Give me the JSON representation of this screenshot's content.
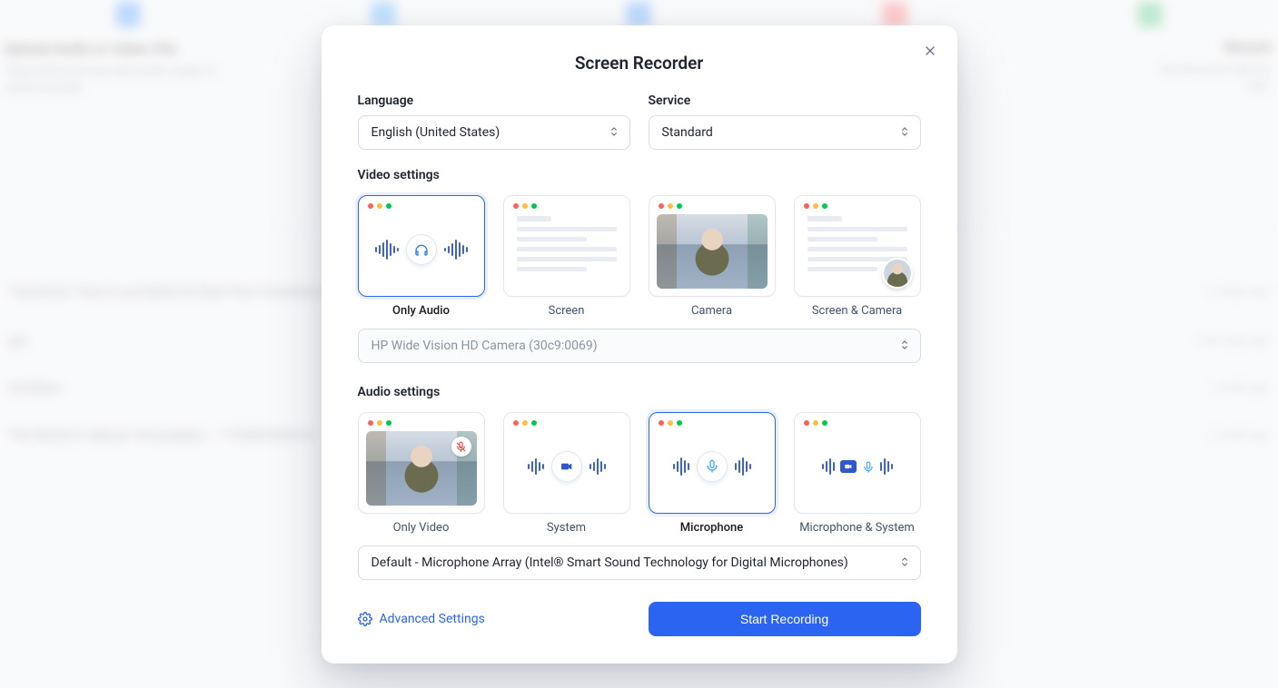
{
  "modal": {
    "title": "Screen Recorder",
    "language": {
      "label": "Language",
      "value": "English (United States)"
    },
    "service": {
      "label": "Service",
      "value": "Standard"
    },
    "video_settings_label": "Video settings",
    "video_options": [
      {
        "label": "Only Audio",
        "selected": true
      },
      {
        "label": "Screen",
        "selected": false
      },
      {
        "label": "Camera",
        "selected": false
      },
      {
        "label": "Screen & Camera",
        "selected": false
      }
    ],
    "camera_select": "HP Wide Vision HD Camera (30c9:0069)",
    "audio_settings_label": "Audio settings",
    "audio_options": [
      {
        "label": "Only Video",
        "selected": false
      },
      {
        "label": "System",
        "selected": false
      },
      {
        "label": "Microphone",
        "selected": true
      },
      {
        "label": "Microphone & System",
        "selected": false
      }
    ],
    "mic_select": "Default - Microphone Array (Intel® Smart Sound Technology for Digital Microphones)",
    "advanced_label": "Advanced Settings",
    "start_label": "Start Recording"
  }
}
